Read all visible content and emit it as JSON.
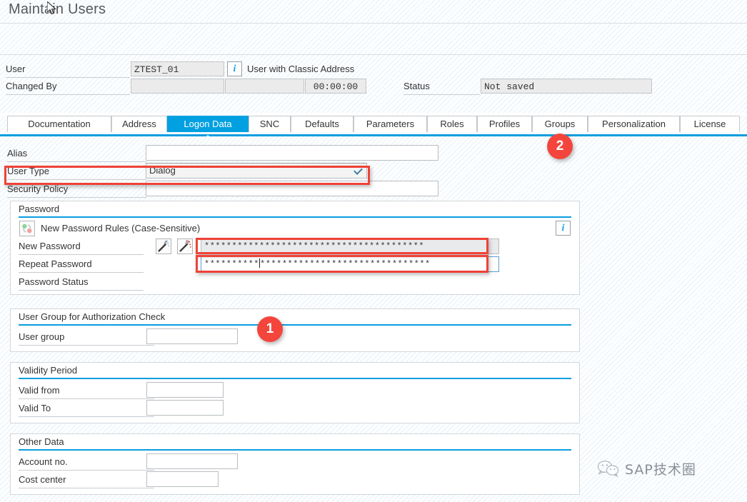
{
  "window": {
    "title": "Maintain Users"
  },
  "toolbar": {
    "org_button_name": "organization-structure-button"
  },
  "header": {
    "user_label": "User",
    "user_value": "ZTEST_01",
    "user_info_icon": "info-icon",
    "user_desc": "User with Classic Address",
    "changed_by_label": "Changed By",
    "changed_by_value": "",
    "changed_on_value": "",
    "changed_time_value": "00:00:00",
    "status_label": "Status",
    "status_value": "Not saved"
  },
  "tabs": [
    {
      "label": "Documentation",
      "active": false
    },
    {
      "label": "Address",
      "active": false
    },
    {
      "label": "Logon Data",
      "active": true
    },
    {
      "label": "SNC",
      "active": false
    },
    {
      "label": "Defaults",
      "active": false
    },
    {
      "label": "Parameters",
      "active": false
    },
    {
      "label": "Roles",
      "active": false
    },
    {
      "label": "Profiles",
      "active": false
    },
    {
      "label": "Groups",
      "active": false
    },
    {
      "label": "Personalization",
      "active": false
    },
    {
      "label": "License",
      "active": false
    }
  ],
  "form": {
    "alias_label": "Alias",
    "alias_value": "",
    "user_type_label": "User Type",
    "user_type_value": "Dialog",
    "security_policy_label": "Security Policy",
    "security_policy_value": ""
  },
  "password_section": {
    "title": "Password",
    "rules_icon": "password-rules-icon",
    "rules_label": "New Password Rules (Case-Sensitive)",
    "info_icon": "info-icon",
    "new_password_label": "New Password",
    "repeat_password_label": "Repeat Password",
    "password_status_label": "Password Status",
    "password_status_value": "",
    "generate_button_icon": "wand-icon",
    "generate_alt_button_icon": "wand-sparkle-icon",
    "new_password_masked": "****************************************",
    "repeat_password_masked_before_caret": "**********",
    "repeat_password_masked_after_caret": "*******************************"
  },
  "user_group_section": {
    "title": "User Group for Authorization Check",
    "user_group_label": "User group",
    "user_group_value": ""
  },
  "validity_section": {
    "title": "Validity Period",
    "valid_from_label": "Valid from",
    "valid_from_value": "",
    "valid_to_label": "Valid To",
    "valid_to_value": ""
  },
  "other_data_section": {
    "title": "Other Data",
    "account_no_label": "Account no.",
    "account_no_value": "",
    "cost_center_label": "Cost center",
    "cost_center_value": ""
  },
  "annotations": {
    "badge_1": "1",
    "badge_2": "2"
  },
  "watermark": {
    "text": "SAP技术圈",
    "icon": "wechat-icon"
  },
  "colors": {
    "accent": "#00a0e1",
    "annotation_red": "#ef4237",
    "field_grey": "#ebebeb"
  }
}
